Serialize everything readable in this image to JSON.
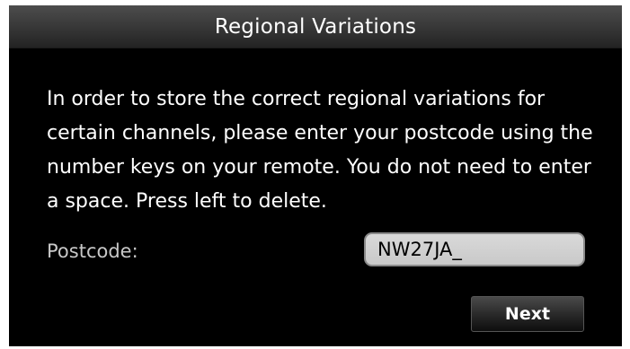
{
  "dialog": {
    "title": "Regional Variations",
    "instructions": "In order to store the correct regional variations for certain channels, please enter your postcode using the number keys on your remote. You do not need to enter a space. Press left to delete.",
    "postcode_label": "Postcode:",
    "postcode_value": "NW27JA_",
    "next_label": "Next"
  }
}
